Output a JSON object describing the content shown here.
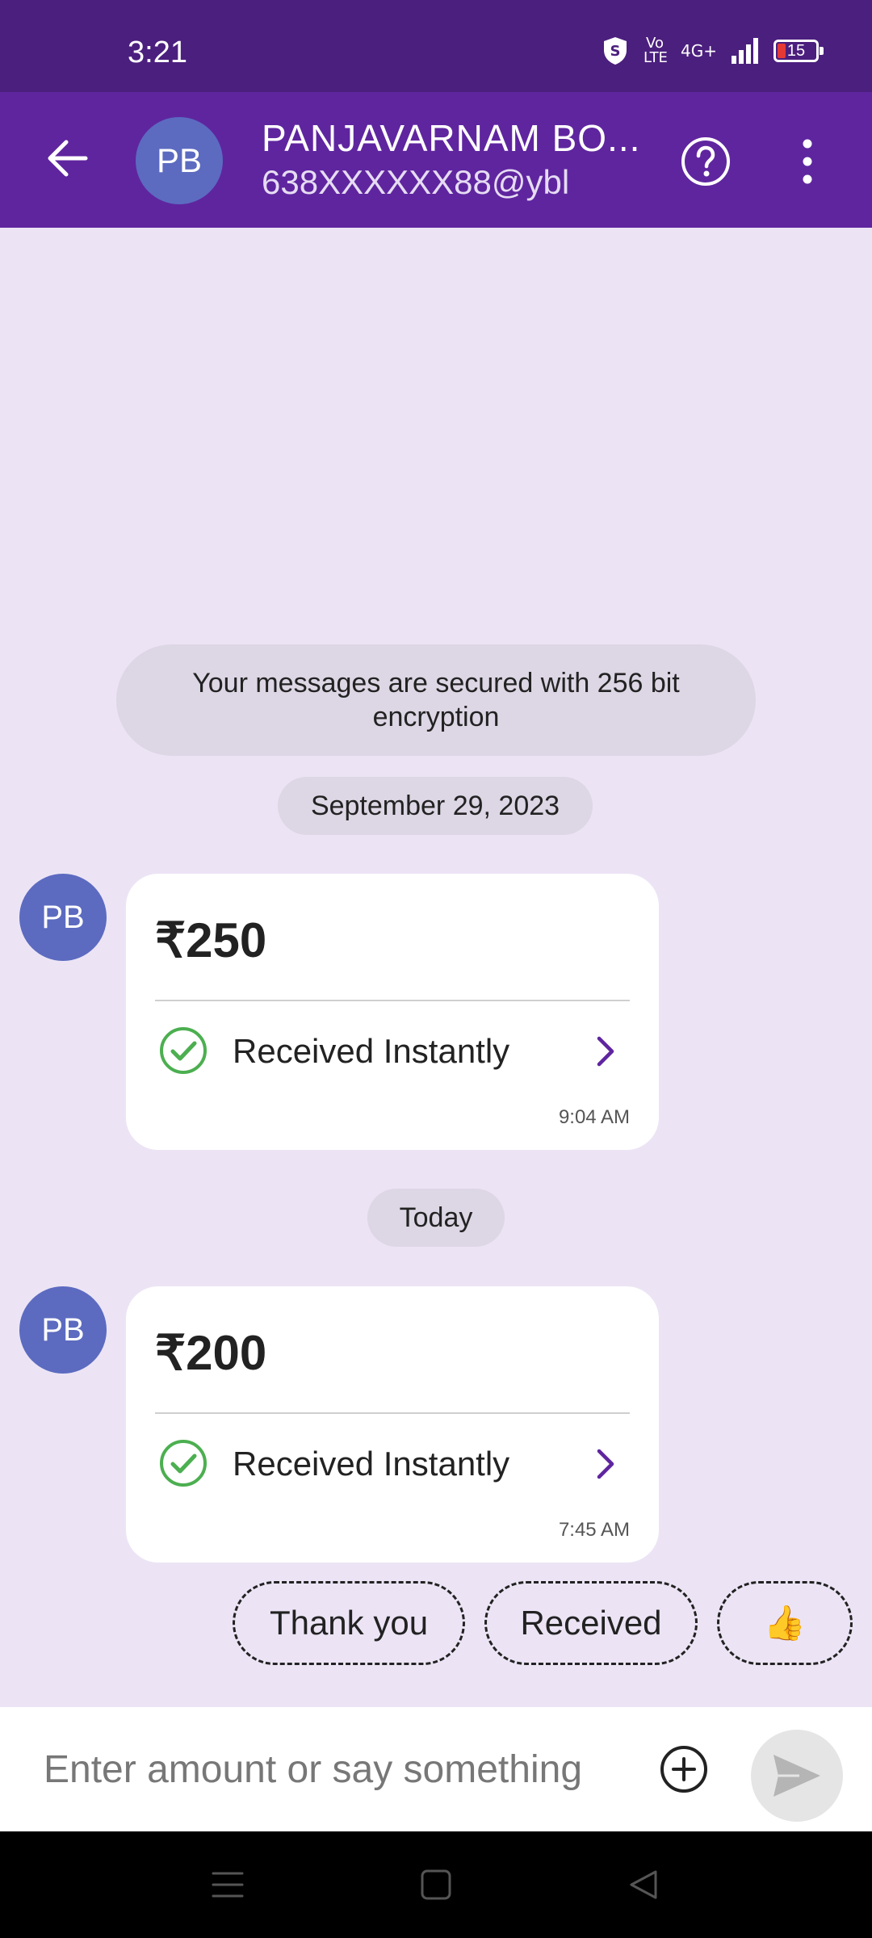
{
  "status_bar": {
    "time": "3:21",
    "volte": "Vo LTE",
    "network": "4G+",
    "battery": "15"
  },
  "header": {
    "avatar_initials": "PB",
    "name": "PANJAVARNAM  BO...",
    "upi_id": "638XXXXXX88@ybl"
  },
  "chat": {
    "encryption_notice": "Your messages are secured with 256 bit encryption",
    "groups": [
      {
        "date": "September 29, 2023",
        "message": {
          "avatar_initials": "PB",
          "amount": "₹250",
          "status": "Received Instantly",
          "time": "9:04 AM"
        }
      },
      {
        "date": "Today",
        "message": {
          "avatar_initials": "PB",
          "amount": "₹200",
          "status": "Received Instantly",
          "time": "7:45 AM"
        }
      }
    ]
  },
  "quick_replies": [
    "Thank you",
    "Received",
    "👍"
  ],
  "input": {
    "placeholder": "Enter amount or say something"
  },
  "colors": {
    "brand_purple": "#5f259f",
    "status_purple": "#4b1f7e",
    "chat_background": "#ece4f5",
    "avatar_blue": "#5c6bc0",
    "success_green": "#4caf50"
  },
  "icons": {
    "back": "arrow-left-icon",
    "help": "question-circle-icon",
    "more": "vertical-dots-icon",
    "success": "check-circle-icon",
    "chevron": "chevron-right-icon",
    "add": "plus-circle-icon",
    "send": "send-icon"
  }
}
